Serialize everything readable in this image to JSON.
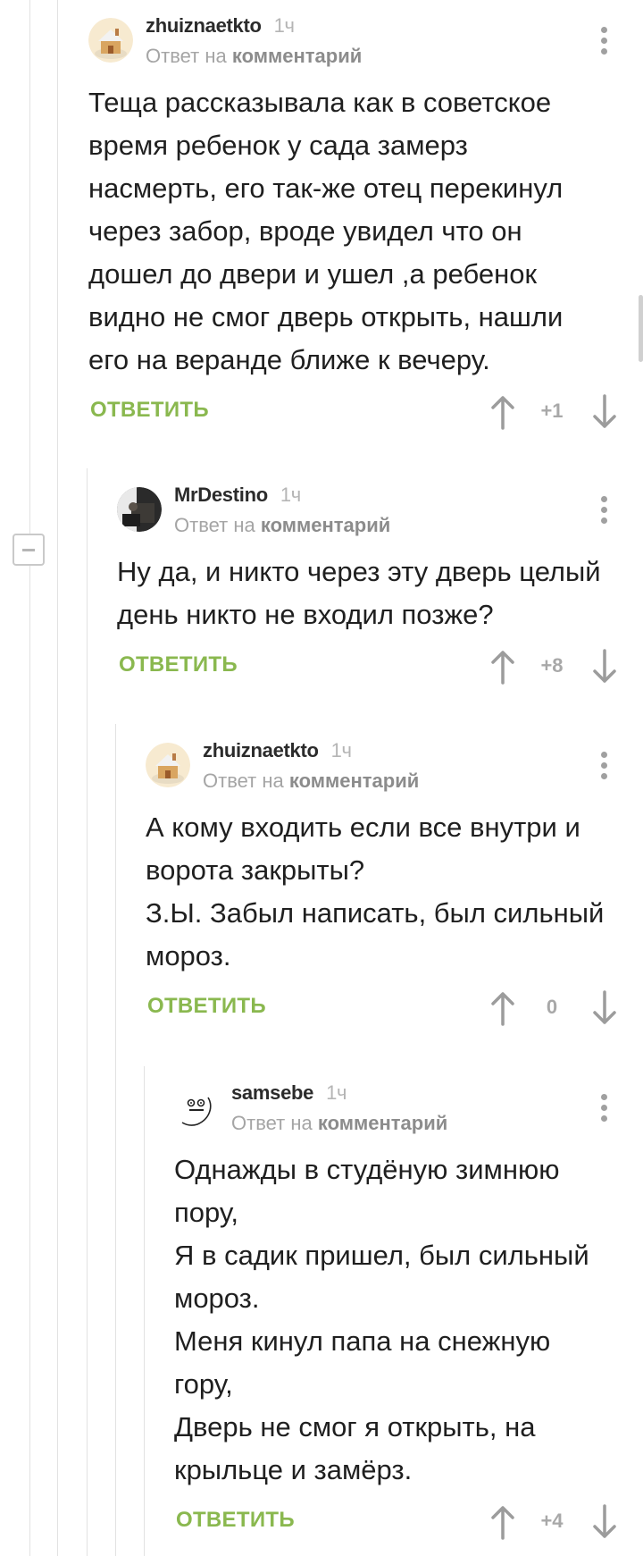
{
  "comments": [
    {
      "username": "zhuiznaetkto",
      "time": "1ч",
      "reply_prefix": "Ответ на",
      "reply_target": "комментарий",
      "text": "Теща рассказывала как в советское время ребенок у сада замерз насмерть, его так-же отец перекинул через забор, вроде увидел что он дошел до двери и ушел ,а ребенок видно не смог дверь открыть, нашли его на веранде ближе к вечеру.",
      "reply_label": "ОТВЕТИТЬ",
      "rating": "+1",
      "avatar": "cottage-avatar"
    },
    {
      "username": "MrDestino",
      "time": "1ч",
      "reply_prefix": "Ответ на",
      "reply_target": "комментарий",
      "text": "Ну да, и никто через эту дверь целый день никто не входил позже?",
      "reply_label": "ОТВЕТИТЬ",
      "rating": "+8",
      "avatar": "photo-avatar"
    },
    {
      "username": "zhuiznaetkto",
      "time": "1ч",
      "reply_prefix": "Ответ на",
      "reply_target": "комментарий",
      "text": "А кому входить если все внутри и ворота закрыты?\nЗ.Ы. Забыл написать, был сильный мороз.",
      "reply_label": "ОТВЕТИТЬ",
      "rating": "0",
      "avatar": "cottage-avatar"
    },
    {
      "username": "samsebe",
      "time": "1ч",
      "reply_prefix": "Ответ на",
      "reply_target": "комментарий",
      "text": "Однажды в студёную зимнюю\nпору,\nЯ в садик пришел, был сильный\nмороз.\nМеня кинул папа на снежную\nгору,\nДверь не смог я открыть, на\nкрыльце и замёрз.",
      "reply_label": "ОТВЕТИТЬ",
      "rating": "+4",
      "avatar": "face-doodle-avatar"
    }
  ],
  "colors": {
    "accent_green": "#8ab84f",
    "muted_gray": "#a5a5a5",
    "thread_line": "#e2e2e2"
  }
}
